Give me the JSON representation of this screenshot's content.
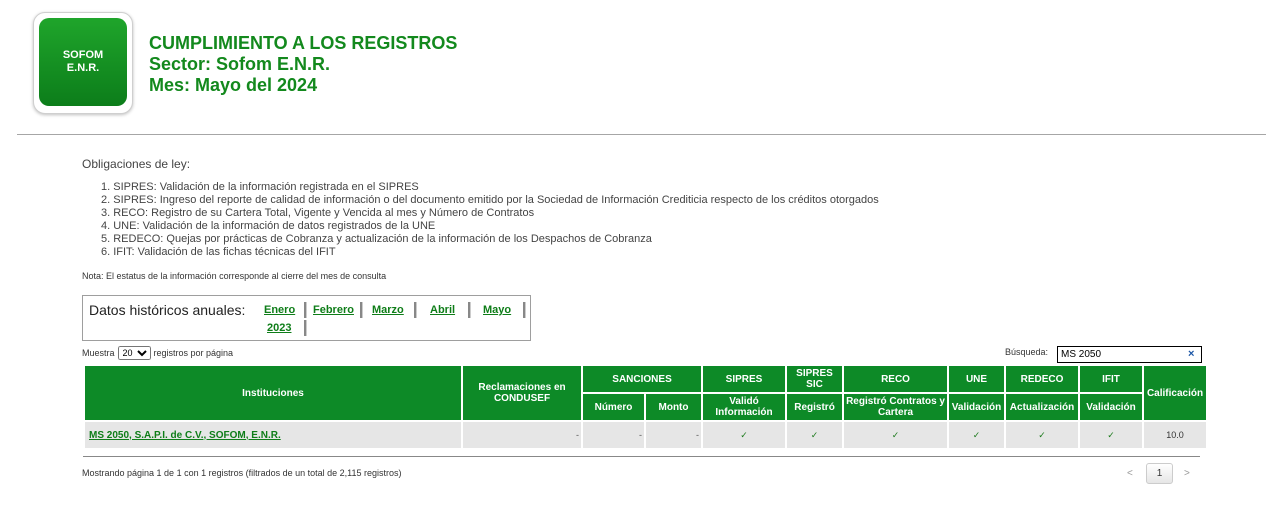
{
  "logo": {
    "line1": "SOFOM",
    "line2": "E.N.R."
  },
  "header": {
    "title": "CUMPLIMIENTO A LOS REGISTROS",
    "sector": "Sector: Sofom E.N.R.",
    "mes": "Mes: Mayo del 2024"
  },
  "obligaciones": {
    "title": "Obligaciones de ley:",
    "items": [
      "1. SIPRES: Validación de la información registrada en el SIPRES",
      "2. SIPRES: Ingreso del reporte de calidad de información o del documento emitido por la Sociedad de Información Crediticia respecto de los créditos otorgados",
      "3. RECO: Registro de su Cartera Total, Vigente y Vencida al mes y Número de Contratos",
      "4. UNE: Validación de la información de datos registrados de la UNE",
      "5. REDECO: Quejas por prácticas de Cobranza y actualización de la información de los Despachos de Cobranza",
      "6. IFIT: Validación de las fichas técnicas del IFIT"
    ],
    "nota": "Nota: El estatus de la información corresponde al cierre del mes de consulta"
  },
  "historicos": {
    "label": "Datos históricos anuales:",
    "months": [
      "Enero",
      "Febrero",
      "Marzo",
      "Abril",
      "Mayo"
    ],
    "year": "2023"
  },
  "controls": {
    "muestra": "Muestra",
    "page_size": "20",
    "registros": "registros por página",
    "busqueda_label": "Búsqueda:",
    "busqueda_value": "MS 2050",
    "clear_icon": "×"
  },
  "table": {
    "headers": {
      "instituciones": "Instituciones",
      "reclamaciones": "Reclamaciones en CONDUSEF",
      "sanciones": "SANCIONES",
      "sipres": "SIPRES",
      "sipres_sic": "SIPRES SIC",
      "reco": "RECO",
      "une": "UNE",
      "redeco": "REDECO",
      "ifit": "IFIT",
      "calificacion": "Calificación",
      "numero": "Número",
      "monto": "Monto",
      "valido": "Validó Información",
      "registro": "Registró",
      "registro_contratos": "Registró Contratos y Cartera",
      "validacion": "Validación",
      "actualizacion": "Actualización",
      "validacion_ifit": "Validación"
    },
    "row": {
      "institucion": "MS 2050, S.A.P.I. de C.V., SOFOM, E.N.R.",
      "reclamaciones": "-",
      "numero": "-",
      "monto": "-",
      "check": "✓",
      "calificacion": "10.0"
    }
  },
  "footer": {
    "mostrando": "Mostrando página 1 de 1 con 1 registros (filtrados de un total de 2,115 registros)",
    "prev": "<",
    "page": "1",
    "next": ">"
  }
}
